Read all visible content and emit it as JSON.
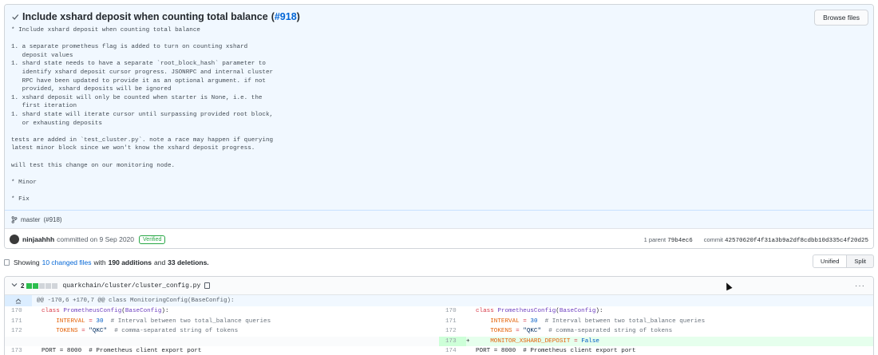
{
  "commit": {
    "title": "Include xshard deposit when counting total balance",
    "pr_link": "#918",
    "browse_files_label": "Browse files",
    "description": "* Include xshard deposit when counting total balance\n\n1. a separate prometheus flag is added to turn on counting xshard\n   deposit values\n1. shard state needs to have a separate `root_block_hash` parameter to\n   identify xshard deposit cursor progress. JSONRPC and internal cluster\n   RPC have been updated to provide it as an optional argument. if not\n   provided, xshard deposits will be ignored\n1. xshard deposit will only be counted when starter is None, i.e. the\n   first iteration\n1. shard state will iterate cursor until surpassing provided root block,\n   or exhausting deposits\n\ntests are added in `test_cluster.py`. note a race may happen if querying\nlatest minor block since we won't know the xshard deposit progress.\n\nwill test this change on our monitoring node.\n\n* Minor\n\n* Fix",
    "branch": "master",
    "branch_pr": "(#918)",
    "author": "ninjaahhh",
    "committed_text": "committed on 9 Sep 2020",
    "verified_label": "Verified",
    "parent_label": "1 parent",
    "parent_sha": "79b4ec6",
    "commit_label": "commit",
    "commit_sha": "42570620f4f31a3b9a2df8cdbb10d335c4f20d25"
  },
  "toolbar": {
    "showing": "Showing",
    "changed_files": "10 changed files",
    "with": "with",
    "additions": "190 additions",
    "and": "and",
    "deletions": "33 deletions.",
    "unified_label": "Unified",
    "split_label": "Split"
  },
  "diff": {
    "stat_count": "2",
    "file_path": "quarkchain/cluster/cluster_config.py",
    "hunk_header": "@@ -170,6 +170,7 @@ class MonitoringConfig(BaseConfig):",
    "left": {
      "ln1": "170",
      "ln2": "171",
      "ln3": "172",
      "ln5": "173",
      "line5": "PORT = 8000  # Prometheus client export port"
    },
    "right": {
      "ln1": "170",
      "ln2": "171",
      "ln3": "172",
      "ln4": "173",
      "ln5": "174",
      "line5": "PORT = 8000  # Prometheus client export port"
    },
    "tokens": {
      "class_kw": "class",
      "class_name": "PrometheusConfig",
      "base": "BaseConfig",
      "interval_var": "INTERVAL",
      "interval_val": "30",
      "interval_cmt": "# Interval between two total_balance queries",
      "tokens_var": "TOKENS",
      "tokens_val": "\"QKC\"",
      "tokens_cmt": "# comma-separated string of tokens",
      "monitor_var": "MONITOR_XSHARD_DEPOSIT",
      "monitor_val": "False",
      "add_mark": "+"
    }
  },
  "colors": {
    "accent": "#0366d6",
    "add_green": "#2cbe4e",
    "verified_green": "#28a745"
  }
}
